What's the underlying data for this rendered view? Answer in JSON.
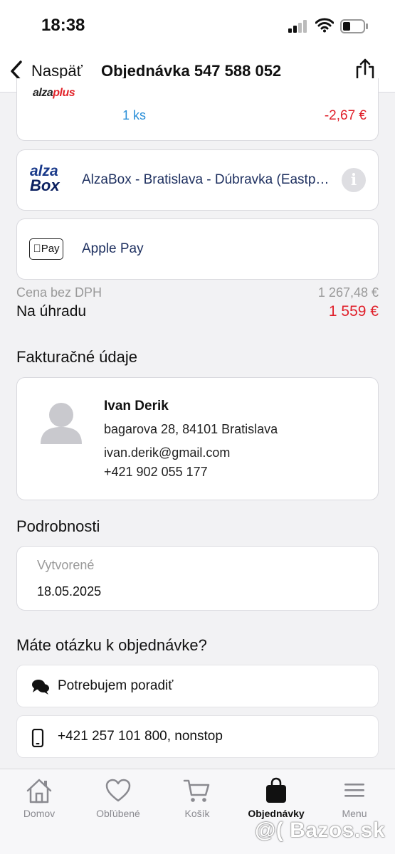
{
  "status_bar": {
    "time": "18:38"
  },
  "nav": {
    "back_label": "Naspäť",
    "title": "Objednávka 547 588 052"
  },
  "item": {
    "brand_prefix": "alza",
    "brand_suffix": "plus",
    "quantity": "1 ks",
    "price": "-2,67 €"
  },
  "delivery": {
    "logo_line1": "alza",
    "logo_line2": "Box",
    "label": "AlzaBox - Bratislava - Dúbravka (Eastpoint)"
  },
  "payment": {
    "logo": "Pay",
    "label": "Apple Pay"
  },
  "totals": {
    "ex_vat_label": "Cena bez DPH",
    "ex_vat_value": "1 267,48 €",
    "to_pay_label": "Na úhradu",
    "to_pay_value": "1 559 €"
  },
  "billing": {
    "heading": "Fakturačné údaje",
    "name": "Ivan Derik",
    "address": "bagarova 28, 84101 Bratislava",
    "email": "ivan.derik@gmail.com",
    "phone": "+421 902 055 177"
  },
  "details": {
    "heading": "Podrobnosti",
    "created_label": "Vytvorené",
    "created_value": "18.05.2025"
  },
  "help": {
    "heading": "Máte otázku k objednávke?",
    "advice_label": "Potrebujem poradiť",
    "phone_label": "+421 257 101 800, nonstop"
  },
  "tabbar": {
    "items": [
      {
        "label": "Domov",
        "icon": "home-icon"
      },
      {
        "label": "Obľúbené",
        "icon": "heart-icon"
      },
      {
        "label": "Košík",
        "icon": "cart-icon"
      },
      {
        "label": "Objednávky",
        "icon": "bag-icon",
        "active": true
      },
      {
        "label": "Menu",
        "icon": "menu-icon"
      }
    ]
  },
  "watermark": "@( Bazos.sk",
  "colors": {
    "accent_red": "#e0202a",
    "link_blue": "#2a8fd8",
    "navy": "#1d2f5f"
  }
}
